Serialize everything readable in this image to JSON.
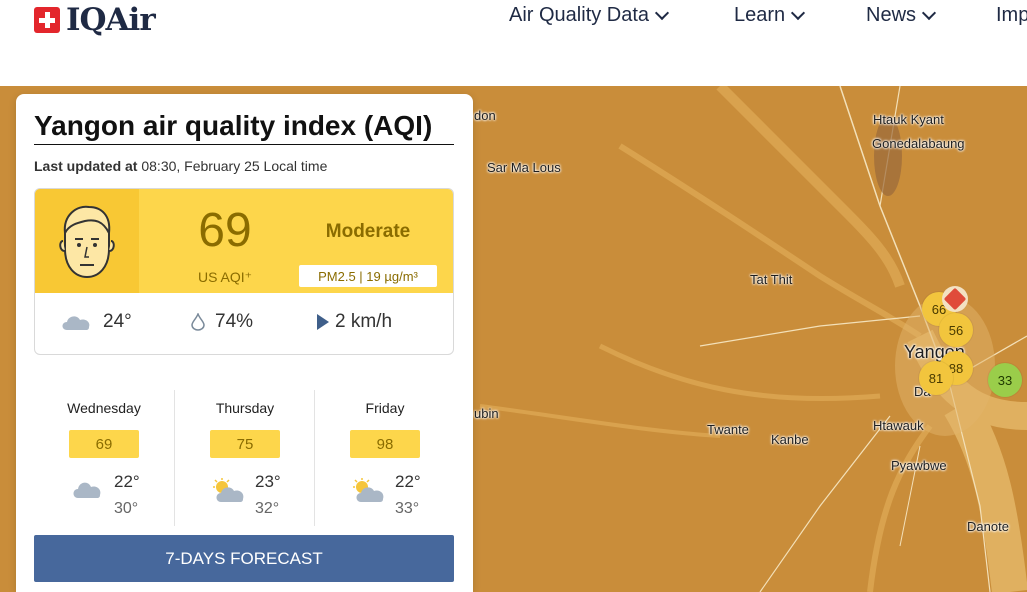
{
  "header": {
    "logo_text": "IQAir",
    "nav": [
      {
        "label": "Air Quality Data"
      },
      {
        "label": "Learn"
      },
      {
        "label": "News"
      },
      {
        "label": "Imp"
      }
    ]
  },
  "card": {
    "title": "Yangon air quality index (AQI)",
    "updated_label": "Last updated at",
    "updated_value": "08:30, February 25 Local time",
    "aqi": {
      "value": "69",
      "unit": "US AQI⁺",
      "level": "Moderate",
      "pollutant": "PM2.5 | 19 µg/m³",
      "color": "#fdd64b"
    },
    "weather": {
      "temp": "24°",
      "humidity": "74%",
      "wind": "2 km/h"
    },
    "forecast": [
      {
        "day": "Wednesday",
        "aqi": "69",
        "hi": "22°",
        "lo": "30°",
        "icon": "cloud-icon"
      },
      {
        "day": "Thursday",
        "aqi": "75",
        "hi": "23°",
        "lo": "32°",
        "icon": "partly-sunny-icon"
      },
      {
        "day": "Friday",
        "aqi": "98",
        "hi": "22°",
        "lo": "33°",
        "icon": "partly-sunny-icon"
      }
    ],
    "forecast_button": "7-DAYS FORECAST"
  },
  "map": {
    "places": [
      {
        "name": "don"
      },
      {
        "name": "Sar Ma Lous"
      },
      {
        "name": "Htauk Kyant"
      },
      {
        "name": "Gonedalabaung"
      },
      {
        "name": "Tat Thit"
      },
      {
        "name": "Yangon"
      },
      {
        "name": "Twante"
      },
      {
        "name": "Kanbe"
      },
      {
        "name": "Htawauk"
      },
      {
        "name": "Pyawbwe"
      },
      {
        "name": "Danote"
      },
      {
        "name": "ubin"
      },
      {
        "name": "Da"
      }
    ],
    "stations": [
      "66",
      "56",
      "88",
      "81",
      "33"
    ]
  }
}
